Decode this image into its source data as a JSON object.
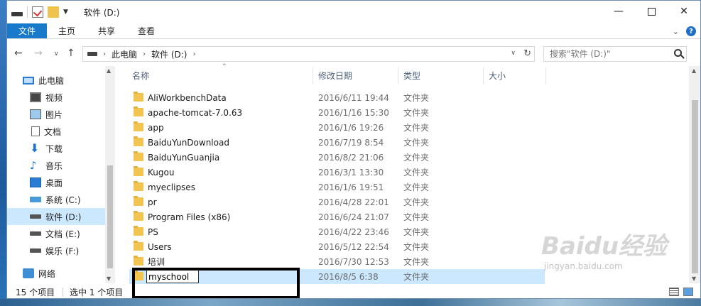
{
  "window": {
    "title": "软件 (D:)",
    "minimize": "—",
    "close": "✕"
  },
  "ribbon": {
    "tabs": [
      "文件",
      "主页",
      "共享",
      "查看"
    ],
    "help": "?"
  },
  "address": {
    "crumbs": [
      "此电脑",
      "软件 (D:)"
    ],
    "search_placeholder": "搜索\"软件 (D:)\""
  },
  "nav_pane": {
    "items": [
      {
        "label": "此电脑",
        "icon": "pc-icon"
      },
      {
        "label": "视频",
        "icon": "video-icon"
      },
      {
        "label": "图片",
        "icon": "picture-icon"
      },
      {
        "label": "文档",
        "icon": "document-icon"
      },
      {
        "label": "下载",
        "icon": "download-icon"
      },
      {
        "label": "音乐",
        "icon": "music-icon"
      },
      {
        "label": "桌面",
        "icon": "desktop-icon"
      },
      {
        "label": "系统 (C:)",
        "icon": "system-drive-icon"
      },
      {
        "label": "软件 (D:)",
        "icon": "drive-icon",
        "selected": true
      },
      {
        "label": "文档 (E:)",
        "icon": "drive-icon"
      },
      {
        "label": "娱乐 (F:)",
        "icon": "drive-icon"
      },
      {
        "label": "网络",
        "icon": "network-icon"
      }
    ]
  },
  "file_list": {
    "columns": [
      "名称",
      "修改日期",
      "类型",
      "大小"
    ],
    "rows": [
      {
        "name": "AliWorkbenchData",
        "date": "2016/6/11 19:44",
        "type": "文件夹"
      },
      {
        "name": "apache-tomcat-7.0.63",
        "date": "2016/1/16 15:30",
        "type": "文件夹"
      },
      {
        "name": "app",
        "date": "2016/1/6 19:26",
        "type": "文件夹"
      },
      {
        "name": "BaiduYunDownload",
        "date": "2016/7/19 8:54",
        "type": "文件夹"
      },
      {
        "name": "BaiduYunGuanjia",
        "date": "2016/8/2 21:06",
        "type": "文件夹"
      },
      {
        "name": "Kugou",
        "date": "2016/3/1 13:30",
        "type": "文件夹"
      },
      {
        "name": "myeclipses",
        "date": "2016/1/6 19:51",
        "type": "文件夹"
      },
      {
        "name": "pr",
        "date": "2016/4/28 22:01",
        "type": "文件夹"
      },
      {
        "name": "Program Files (x86)",
        "date": "2016/6/24 21:07",
        "type": "文件夹"
      },
      {
        "name": "PS",
        "date": "2016/4/22 23:46",
        "type": "文件夹"
      },
      {
        "name": "Users",
        "date": "2016/5/12 22:54",
        "type": "文件夹"
      },
      {
        "name": "培训",
        "date": "2016/7/30 12:53",
        "type": "文件夹"
      }
    ],
    "renaming": {
      "name": "myschool",
      "date": "2016/8/5 6:38",
      "type": "文件夹"
    }
  },
  "status": {
    "count": "15 个项目",
    "selected": "选中 1 个项目"
  },
  "watermark": {
    "logo": "Baidu经验",
    "url": "jingyan.baidu.com"
  }
}
